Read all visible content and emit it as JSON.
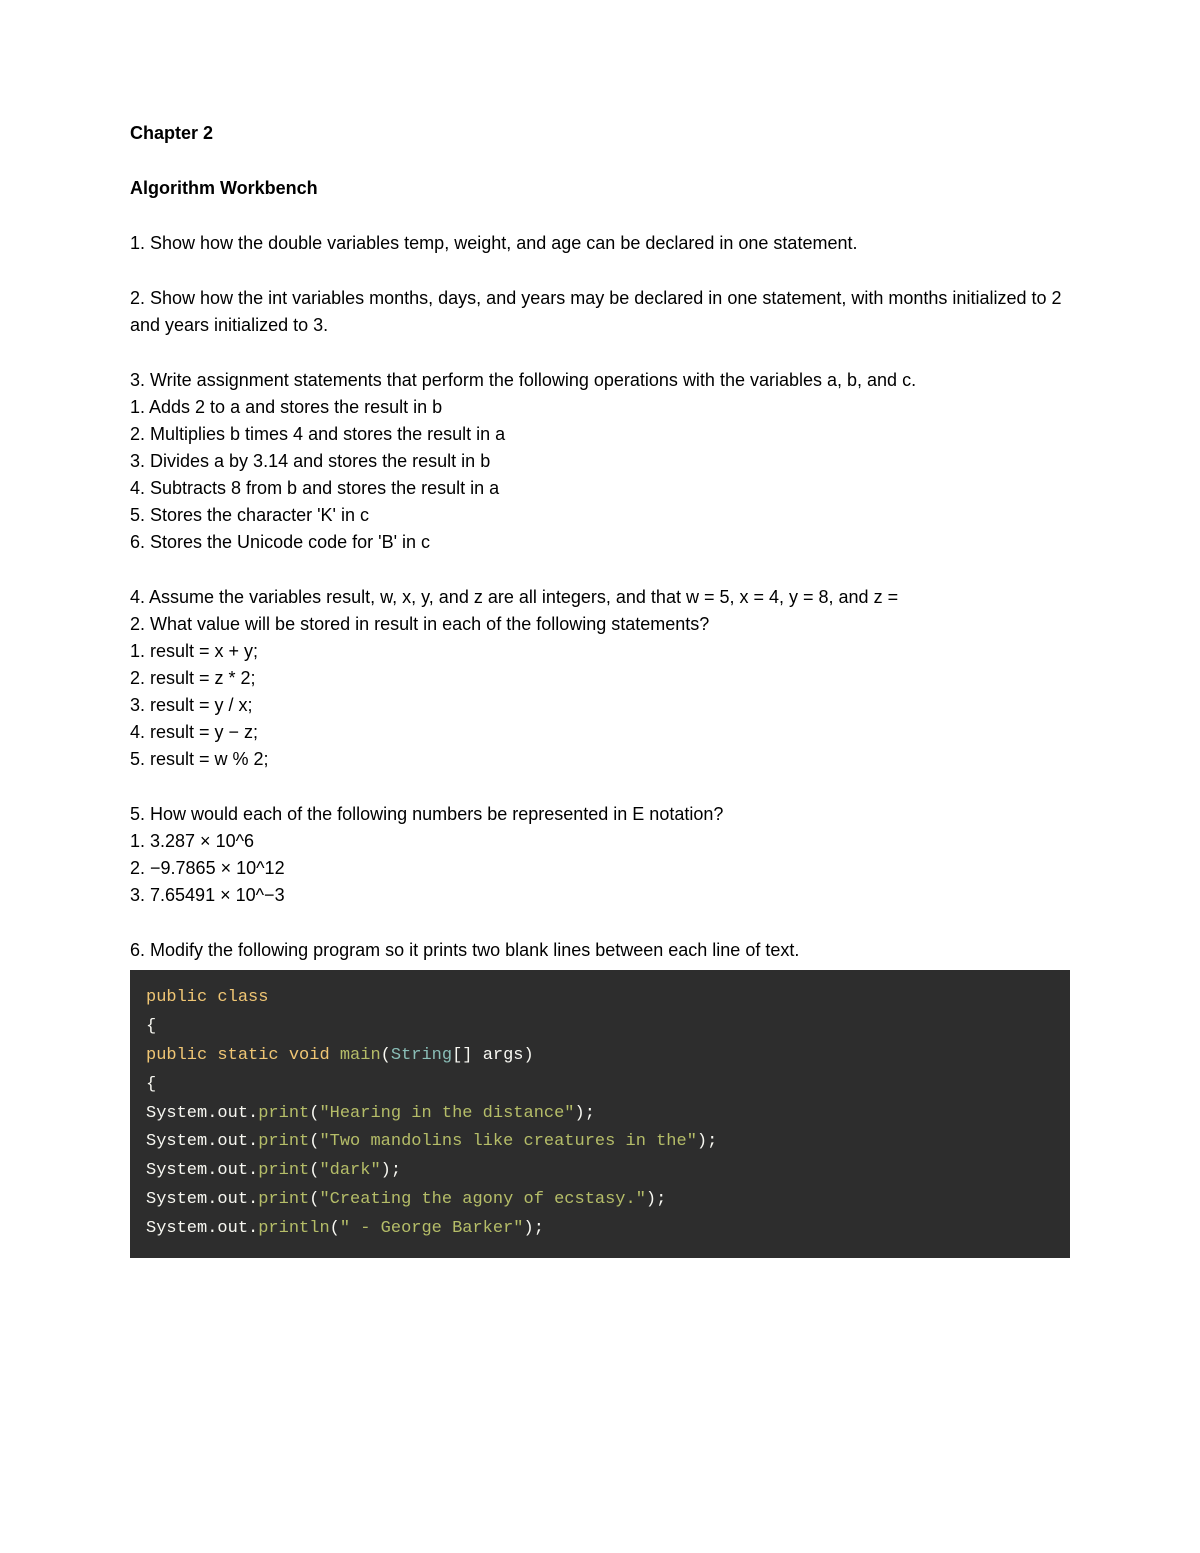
{
  "chapter": "Chapter 2",
  "section": "Algorithm Workbench",
  "q1": "1. Show how the double variables temp, weight, and age can be declared in one statement.",
  "q2": "2. Show how the int variables months, days, and years may be declared in one statement, with months initialized to 2 and years initialized to 3.",
  "q3": {
    "prompt": "3. Write assignment statements that perform the following operations with the variables a, b, and c.",
    "items": {
      "i1": "1. Adds 2 to a and stores the result in b",
      "i2": "2. Multiplies b times 4 and stores the result in a",
      "i3": "3. Divides a by 3.14 and stores the result in b",
      "i4": "4. Subtracts 8 from b and stores the result in a",
      "i5": "5. Stores the character 'K' in c",
      "i6": "6. Stores the Unicode code for 'B' in c"
    }
  },
  "q4": {
    "prompt": "4. Assume the variables result, w, x, y, and z are all integers, and that w = 5, x = 4, y = 8, and z =",
    "prompt2": "2. What value will be stored in result in each of the following statements?",
    "items": {
      "i1": "1. result = x + y;",
      "i2": "2. result = z * 2;",
      "i3": "3. result = y / x;",
      "i4": "4. result = y − z;",
      "i5": "5. result = w % 2;"
    }
  },
  "q5": {
    "prompt": "5. How would each of the following numbers be represented in E notation?",
    "items": {
      "i1": "1. 3.287 × 10^6",
      "i2": "2. −9.7865 × 10^12",
      "i3": "3. 7.65491 × 10^−3"
    }
  },
  "q6": "6. Modify the following program so it prints two blank lines between each line of text.",
  "code": {
    "kw_public": "public",
    "kw_class": "class",
    "brace_open": "{",
    "kw_static": "static",
    "kw_void": "void",
    "fn_main": "main",
    "paren_open": "(",
    "type_string": "String",
    "brackets": "[] ",
    "args": "args",
    "paren_close": ")",
    "sys": "System",
    "dot": ".",
    "out": "out",
    "print": "print",
    "println": "println",
    "semi": ";",
    "str1": "\"Hearing in the distance\"",
    "str2": "\"Two mandolins like creatures in the\"",
    "str3": "\"dark\"",
    "str4": "\"Creating the agony of ecstasy.\"",
    "str5": "\" - George Barker\""
  }
}
